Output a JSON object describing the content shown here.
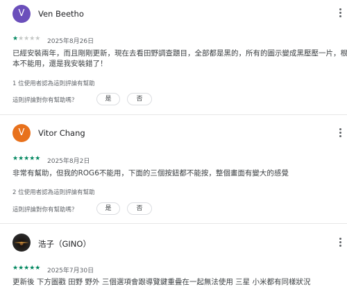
{
  "reviews": [
    {
      "avatar_letter": "V",
      "name": "Ven Beetho",
      "rating": 1,
      "stars": "★★★★★",
      "date": "2025年8月26日",
      "text_lines": [
        "已經安裝兩年，而且剛剛更新，現在去看田野調查題目，全部都是黑的，所有的圖示變成黑壓壓一片，根",
        "本不能用，還是我安裝錯了！"
      ],
      "helpful_count": "1 位使用者認為這則評論有幫助",
      "helpful_question": "這則評論對你有幫助嗎？",
      "yes_label": "是",
      "no_label": "否"
    },
    {
      "avatar_letter": "V",
      "name": "Vitor Chang",
      "rating": 5,
      "stars": "★★★★★",
      "date": "2025年8月2日",
      "text_lines": [
        "非常有幫助，但我的ROG6不能用，下面的三個按鈕都不能按，整個畫面有變大的感覺"
      ],
      "helpful_count": "2 位使用者認為這則評論有幫助",
      "helpful_question": "這則評論對你有幫助嗎？",
      "yes_label": "是",
      "no_label": "否"
    },
    {
      "avatar_letter": "",
      "name": "浩子（GINO）",
      "rating": 5,
      "stars": "★★★★★",
      "date": "2025年7月30日",
      "text_lines": [
        "更新後 下方圖戳 田野 野外 三個選項會跟導覽鍵重疊在一起無法使用 三星 小米都有同樣狀況"
      ]
    }
  ],
  "colors": {
    "star_filled": "#01875f",
    "star_empty": "#c4c7c5",
    "avatar_1": "#6b4fbb",
    "avatar_2": "#e8711c"
  },
  "icons": {
    "menu": "more-vert-icon"
  }
}
